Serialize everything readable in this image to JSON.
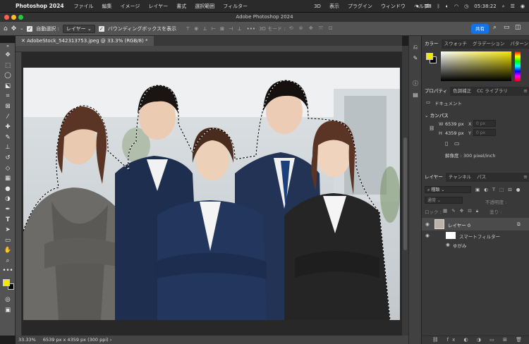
{
  "menubar": {
    "app": "Photoshop 2024",
    "items": [
      "ファイル",
      "編集",
      "イメージ",
      "レイヤー",
      "書式",
      "選択範囲",
      "フィルター",
      "3D",
      "表示",
      "プラグイン",
      "ウィンドウ",
      "ヘルプ"
    ],
    "clock": "05:38:22"
  },
  "window": {
    "title": "Adobe Photoshop 2024"
  },
  "options": {
    "auto_select": "自動選択 :",
    "layer_dropdown": "レイヤー",
    "bbox": "バウンディングボックスを表示",
    "mode_3d": "3D モード :",
    "share": "共有"
  },
  "document": {
    "tab": "AdobeStock_542313753.jpeg @ 33.3% (RGB/8) *"
  },
  "status": {
    "zoom": "33.33%",
    "info": "6539 px x 4359 px (300 ppi)"
  },
  "panels": {
    "color": {
      "tabs": [
        "カラー",
        "スウォッチ",
        "グラデーション",
        "パターン"
      ]
    },
    "properties": {
      "tabs": [
        "プロパティ",
        "色調補正",
        "CC ライブラリ"
      ],
      "doc_label": "ドキュメント",
      "canvas_label": "カンバス",
      "w_label": "W",
      "w_value": "6539 px",
      "x_label": "X",
      "x_value": "0 px",
      "h_label": "H",
      "h_value": "4359 px",
      "y_label": "Y",
      "y_value": "0 px",
      "resolution": "解像度 : 300 pixel/inch"
    },
    "layers": {
      "tabs": [
        "レイヤー",
        "チャンネル",
        "パス"
      ],
      "filter": "種類",
      "blend": "通常",
      "opacity": "不透明度 :",
      "lock": "ロック :",
      "fill": "塗り :",
      "layer_name": "レイヤー 0",
      "smart_filter": "スマートフィルター",
      "distort": "ゆがみ"
    }
  },
  "colors": {
    "foreground": "#f5e800",
    "background": "#000000",
    "accent": "#1473e6"
  }
}
